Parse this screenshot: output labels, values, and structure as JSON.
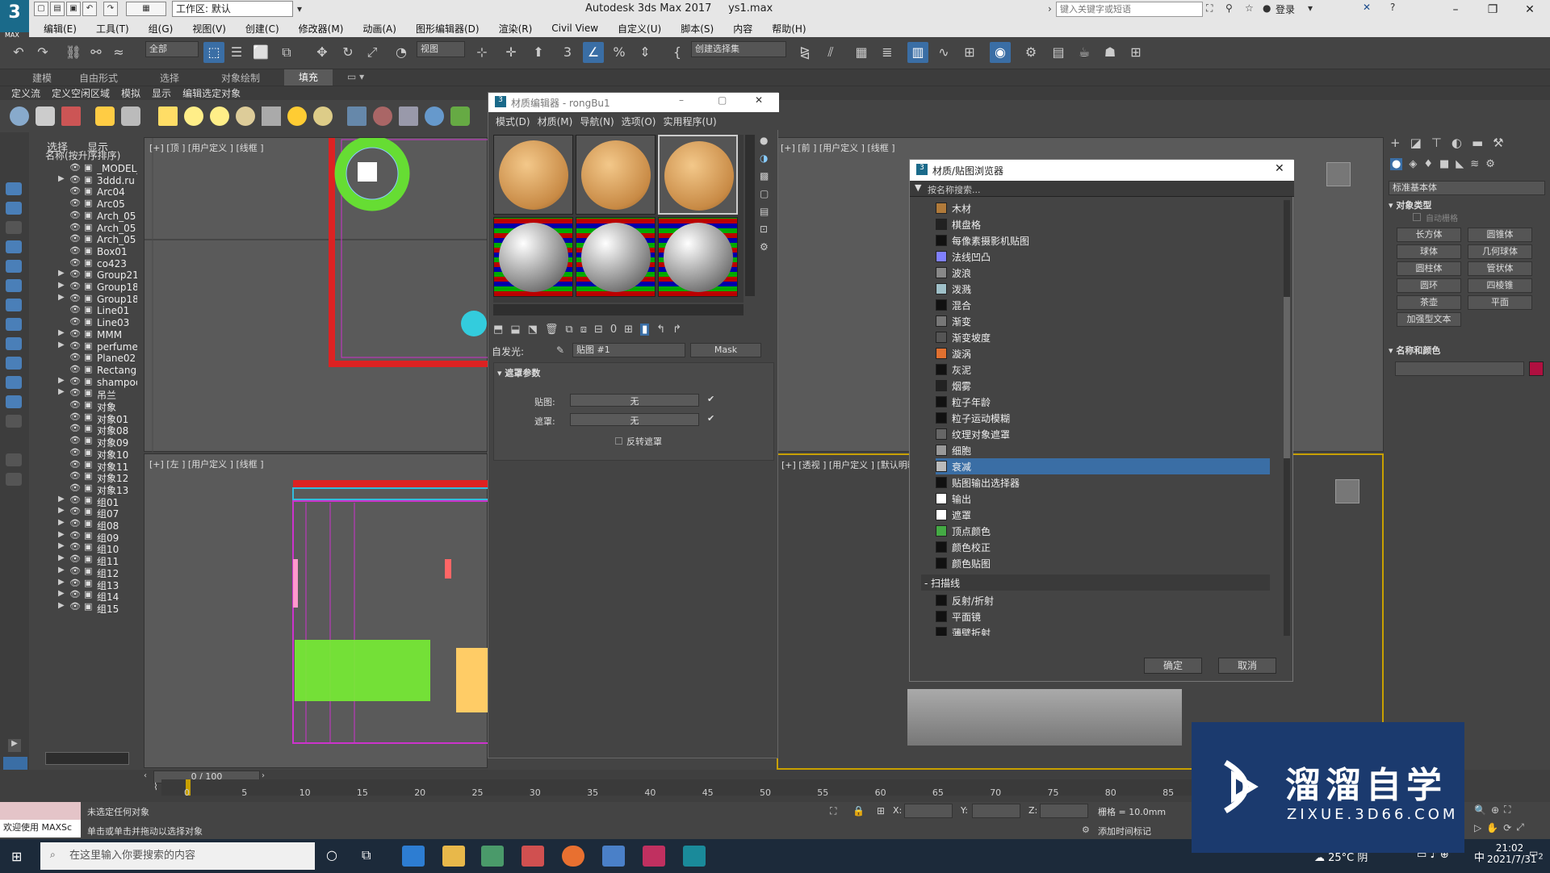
{
  "app": {
    "title": "Autodesk 3ds Max 2017",
    "file": "ys1.max",
    "logo_text": "3",
    "logo_sub": "MAX",
    "workspace": "工作区: 默认",
    "search_placeholder": "键入关键字或短语",
    "login": "登录"
  },
  "menu": [
    "编辑(E)",
    "工具(T)",
    "组(G)",
    "视图(V)",
    "创建(C)",
    "修改器(M)",
    "动画(A)",
    "图形编辑器(D)",
    "渲染(R)",
    "Civil View",
    "自定义(U)",
    "脚本(S)",
    "内容",
    "帮助(H)"
  ],
  "toolbar": {
    "filter": "全部",
    "view": "视图",
    "selection_set": "创建选择集"
  },
  "ribbon_tabs": [
    "建模",
    "自由形式",
    "选择",
    "对象绘制",
    "填充"
  ],
  "ribbon_sub": [
    "定义流",
    "定义空闲区域",
    "模拟",
    "显示",
    "编辑选定对象"
  ],
  "explorer": {
    "tab_select": "选择",
    "tab_display": "显示",
    "sort_label": "名称(按升序排序)",
    "items": [
      {
        "name": "_MODEL_",
        "expand": false
      },
      {
        "name": "3ddd.ru",
        "expand": true
      },
      {
        "name": "Arc04",
        "expand": false
      },
      {
        "name": "Arc05",
        "expand": false
      },
      {
        "name": "Arch_05",
        "expand": false
      },
      {
        "name": "Arch_05",
        "expand": false
      },
      {
        "name": "Arch_05",
        "expand": false
      },
      {
        "name": "Box01",
        "expand": false
      },
      {
        "name": "co423",
        "expand": false
      },
      {
        "name": "Group21",
        "expand": true
      },
      {
        "name": "Group18",
        "expand": true
      },
      {
        "name": "Group18",
        "expand": true
      },
      {
        "name": "Line01",
        "expand": false
      },
      {
        "name": "Line03",
        "expand": false
      },
      {
        "name": "MMM",
        "expand": true
      },
      {
        "name": "perfume",
        "expand": true
      },
      {
        "name": "Plane02",
        "expand": false
      },
      {
        "name": "Rectangl",
        "expand": false
      },
      {
        "name": "shampoo",
        "expand": true
      },
      {
        "name": "吊兰",
        "expand": true
      },
      {
        "name": "对象",
        "expand": false
      },
      {
        "name": "对象01",
        "expand": false
      },
      {
        "name": "对象08",
        "expand": false
      },
      {
        "name": "对象09",
        "expand": false
      },
      {
        "name": "对象10",
        "expand": false
      },
      {
        "name": "对象11",
        "expand": false
      },
      {
        "name": "对象12",
        "expand": false
      },
      {
        "name": "对象13",
        "expand": false
      },
      {
        "name": "组01",
        "expand": true
      },
      {
        "name": "组07",
        "expand": true
      },
      {
        "name": "组08",
        "expand": true
      },
      {
        "name": "组09",
        "expand": true
      },
      {
        "name": "组10",
        "expand": true
      },
      {
        "name": "组11",
        "expand": true
      },
      {
        "name": "组12",
        "expand": true
      },
      {
        "name": "组13",
        "expand": true
      },
      {
        "name": "组14",
        "expand": true
      },
      {
        "name": "组15",
        "expand": true
      }
    ]
  },
  "viewports": {
    "top_left": "[+] [顶 ] [用户定义 ] [线框 ]",
    "bottom_left": "[+] [左 ] [用户定义 ] [线框 ]",
    "top_right": "[+] [前 ] [用户定义 ] [线框 ]",
    "bottom_right": "[+] [透视 ] [用户定义 ] [默认明暗处理 ]"
  },
  "material_editor": {
    "title": "材质编辑器 - rongBu1",
    "menu": [
      "模式(D)",
      "材质(M)",
      "导航(N)",
      "选项(O)",
      "实用程序(U)"
    ],
    "self_illum_label": "自发光:",
    "map_name": "贴图 #1",
    "map_type": "Mask",
    "rollout_title": "遮罩参数",
    "map_label": "贴图:",
    "mask_label": "遮罩:",
    "none": "无",
    "invert_label": "反转遮罩"
  },
  "browser": {
    "title": "材质/贴图浏览器",
    "search": "按名称搜索...",
    "items": [
      {
        "label": "木材",
        "color": "#b07a3a"
      },
      {
        "label": "棋盘格",
        "color": "#222222"
      },
      {
        "label": "每像素摄影机贴图",
        "color": "#111111"
      },
      {
        "label": "法线凹凸",
        "color": "#8080ff"
      },
      {
        "label": "波浪",
        "color": "#888888"
      },
      {
        "label": "泼溅",
        "color": "#9fc0c8"
      },
      {
        "label": "混合",
        "color": "#111111"
      },
      {
        "label": "渐变",
        "color": "#777777"
      },
      {
        "label": "渐变坡度",
        "color": "#555555"
      },
      {
        "label": "漩涡",
        "color": "#e07030"
      },
      {
        "label": "灰泥",
        "color": "#111111"
      },
      {
        "label": "烟雾",
        "color": "#222222"
      },
      {
        "label": "粒子年龄",
        "color": "#111111"
      },
      {
        "label": "粒子运动模糊",
        "color": "#111111"
      },
      {
        "label": "纹理对象遮罩",
        "color": "#666666"
      },
      {
        "label": "细胞",
        "color": "#999999"
      },
      {
        "label": "衰减",
        "color": "#bbbbbb"
      },
      {
        "label": "贴图输出选择器",
        "color": "#111111"
      },
      {
        "label": "输出",
        "color": "#ffffff"
      },
      {
        "label": "遮罩",
        "color": "#ffffff"
      },
      {
        "label": "顶点颜色",
        "color": "#44aa44"
      },
      {
        "label": "颜色校正",
        "color": "#111111"
      },
      {
        "label": "颜色贴图",
        "color": "#111111"
      }
    ],
    "selected": "衰减",
    "group_scanline": "扫描线",
    "scanline_items": [
      {
        "label": "反射/折射",
        "color": "#111111"
      },
      {
        "label": "平面镜",
        "color": "#111111"
      },
      {
        "label": "薄壁折射",
        "color": "#111111"
      }
    ],
    "ok": "确定",
    "cancel": "取消"
  },
  "command_panel": {
    "dropdown": "标准基本体",
    "object_type": "对象类型",
    "autogrid": "自动栅格",
    "buttons": [
      "长方体",
      "圆锥体",
      "球体",
      "几何球体",
      "圆柱体",
      "管状体",
      "圆环",
      "四棱锥",
      "茶壶",
      "平面",
      "加强型文本"
    ],
    "name_color": "名称和颜色"
  },
  "timeline": {
    "frame": "0 / 100",
    "ticks": [
      "0",
      "5",
      "10",
      "15",
      "20",
      "25",
      "30",
      "35",
      "40",
      "45",
      "50",
      "55",
      "60",
      "65",
      "70",
      "75",
      "80",
      "85"
    ]
  },
  "status": {
    "left_box": "欢迎使用 MAXSc",
    "line1": "未选定任何对象",
    "line2": "单击或单击并拖动以选择对象",
    "x_label": "X:",
    "y_label": "Y:",
    "z_label": "Z:",
    "grid": "栅格 = 10.0mm",
    "add_tag": "添加时间标记"
  },
  "taskbar": {
    "search": "在这里输入你要搜索的内容",
    "weather": "25°C 阴",
    "ime": "中",
    "time": "21:02",
    "date": "2021/7/31",
    "notif": "2"
  },
  "watermark": {
    "cn": "溜溜自学",
    "en": "ZIXUE.3D66.COM"
  }
}
